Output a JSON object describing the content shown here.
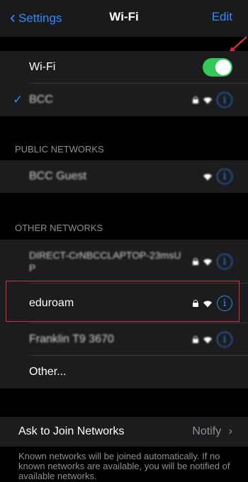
{
  "nav": {
    "back_label": "Settings",
    "title": "Wi-Fi",
    "edit_label": "Edit"
  },
  "wifi_toggle": {
    "label": "Wi-Fi",
    "on": true
  },
  "connected_network": {
    "name": "BCC"
  },
  "public_header": "PUBLIC NETWORKS",
  "public_networks": [
    {
      "name": "BCC Guest"
    }
  ],
  "other_header": "OTHER NETWORKS",
  "other_networks": [
    {
      "name": "DIRECT-CrNBCCLAPTOP-23msUP"
    },
    {
      "name": "eduroam"
    },
    {
      "name": "Franklin T9 3670"
    },
    {
      "name": "Other..."
    }
  ],
  "ask_to_join": {
    "label": "Ask to Join Networks",
    "value": "Notify"
  },
  "footer_text": "Known networks will be joined automatically. If no known networks are available, you will be notified of available networks.",
  "colors": {
    "accent": "#2f8bff",
    "toggle_on": "#34c759",
    "highlight": "#d0313c",
    "background": "#000000",
    "cell": "#1c1c1e"
  },
  "icons": [
    "chevron-left-icon",
    "lock-icon",
    "wifi-icon",
    "info-icon",
    "checkmark-icon",
    "chevron-right-icon",
    "arrow-icon"
  ]
}
